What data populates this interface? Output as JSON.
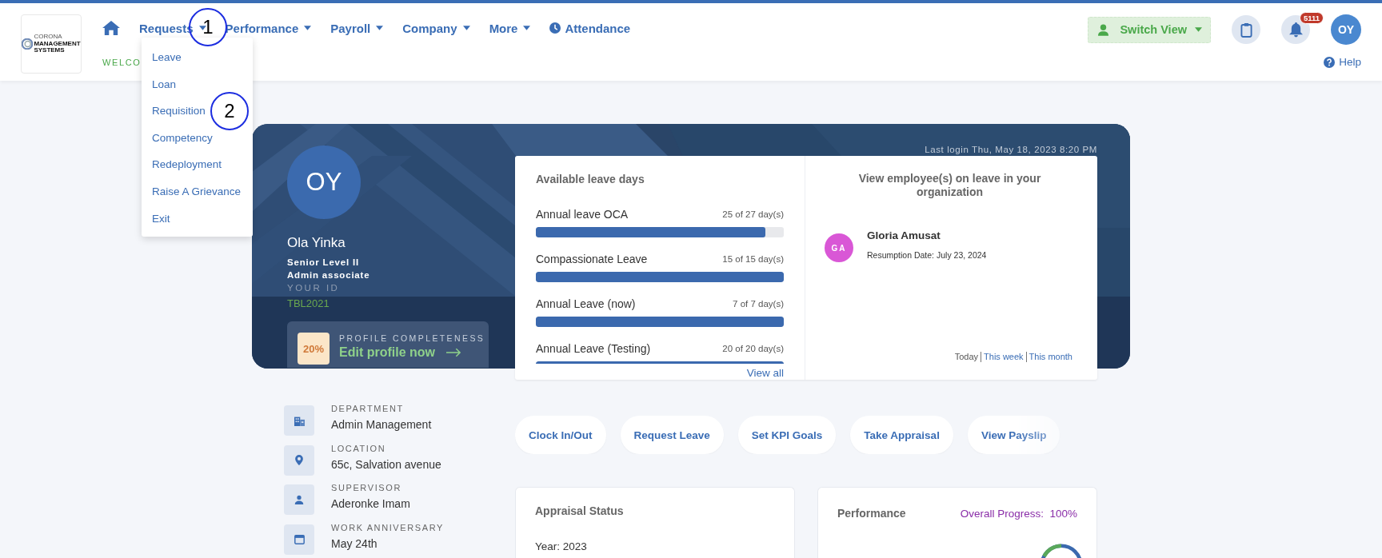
{
  "header": {
    "logo": {
      "lines": [
        "CORONA",
        "MANAGEMENT",
        "SYSTEMS"
      ]
    },
    "nav": [
      {
        "kind": "home"
      },
      {
        "kind": "dropdown",
        "label": "Requests",
        "menu": [
          "Leave",
          "Loan",
          "Requisition",
          "Competency",
          "Redeployment",
          "Raise A Grievance",
          "Exit"
        ]
      },
      {
        "kind": "dropdown",
        "label": "Performance"
      },
      {
        "kind": "dropdown",
        "label": "Payroll"
      },
      {
        "kind": "dropdown",
        "label": "Company"
      },
      {
        "kind": "dropdown",
        "label": "More"
      },
      {
        "kind": "clock",
        "label": "Attendance"
      }
    ],
    "welcome": "WELCO",
    "switch_view": "Switch View",
    "notification_count": "5111",
    "user_initials": "OY",
    "help": "Help"
  },
  "annotations": [
    {
      "label": "1"
    },
    {
      "label": "2"
    }
  ],
  "profile": {
    "initials": "OY",
    "name": "Ola Yinka",
    "grade": "Senior Level II",
    "role": "Admin associate",
    "id_label": "YOUR ID",
    "id": "TBL2021",
    "completeness": {
      "percent": "20%",
      "label": "PROFILE COMPLETENESS",
      "link": "Edit profile now"
    }
  },
  "last_login": "Last login Thu, May 18, 2023 8:20 PM",
  "leave_days": {
    "title": "Available leave days",
    "items": [
      {
        "name": "Annual leave OCA",
        "reading": "25 of 27 day(s)",
        "level": 0.926
      },
      {
        "name": "Compassionate Leave",
        "reading": "15 of 15 day(s)",
        "level": 1
      },
      {
        "name": "Annual Leave (now)",
        "reading": "7 of 7 day(s)",
        "level": 1
      },
      {
        "name": "Annual Leave (Testing)",
        "reading": "20 of 20 day(s)",
        "level": 1
      }
    ],
    "view_all": "View all"
  },
  "on_leave": {
    "title": "View employee(s) on leave in your organization",
    "employees": [
      {
        "initials": "GA",
        "name": "Gloria Amusat",
        "detail": "Resumption Date: July 23, 2024",
        "color": "#d957d6"
      }
    ],
    "filters": [
      {
        "label": "Today",
        "selected": true
      },
      {
        "label": "This week",
        "selected": false
      },
      {
        "label": "This month",
        "selected": false
      }
    ]
  },
  "details": [
    {
      "kind": "department",
      "label": "DEPARTMENT",
      "value": "Admin Management"
    },
    {
      "kind": "location",
      "label": "LOCATION",
      "value": "65c, Salvation avenue"
    },
    {
      "kind": "person",
      "label": "SUPERVISOR",
      "value": "Aderonke Imam"
    },
    {
      "kind": "calendar",
      "label": "WORK ANNIVERSARY",
      "value": "May 24th"
    }
  ],
  "quick_actions": [
    "Clock In/Out",
    "Request Leave",
    "Set KPI Goals",
    "Take Appraisal",
    "View Payslip"
  ],
  "appraisal": {
    "title": "Appraisal Status",
    "year": "Year: 2023"
  },
  "performance": {
    "title": "Performance",
    "progress_label": "Overall Progress:",
    "progress_value": "100%"
  }
}
